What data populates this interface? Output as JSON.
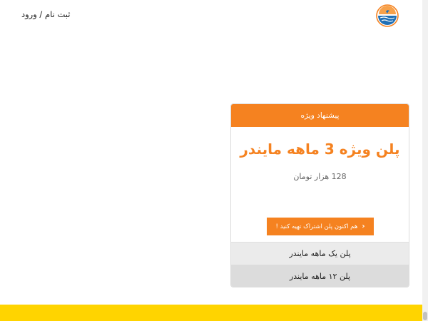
{
  "header": {
    "auth_link": "ثبت نام / ورود",
    "logo_icon": "wave-sun-logo-icon"
  },
  "offer": {
    "header": "پیشنهاد ویژه",
    "title": "پلن ویژه 3 ماهه مایندر",
    "price": "128 هزار تومان",
    "cta_label": "هم اکنون پلن اشتراک تهیه کنید !",
    "cta_icon": "chevron-left-icon"
  },
  "plans": [
    {
      "label": "پلن یک ماهه مایندر"
    },
    {
      "label": "پلن ۱۲ ماهه مایندر"
    }
  ],
  "colors": {
    "accent": "#f58220",
    "footer": "#ffd400",
    "row_light": "#ebebeb",
    "row_dark": "#dcdcdc"
  }
}
